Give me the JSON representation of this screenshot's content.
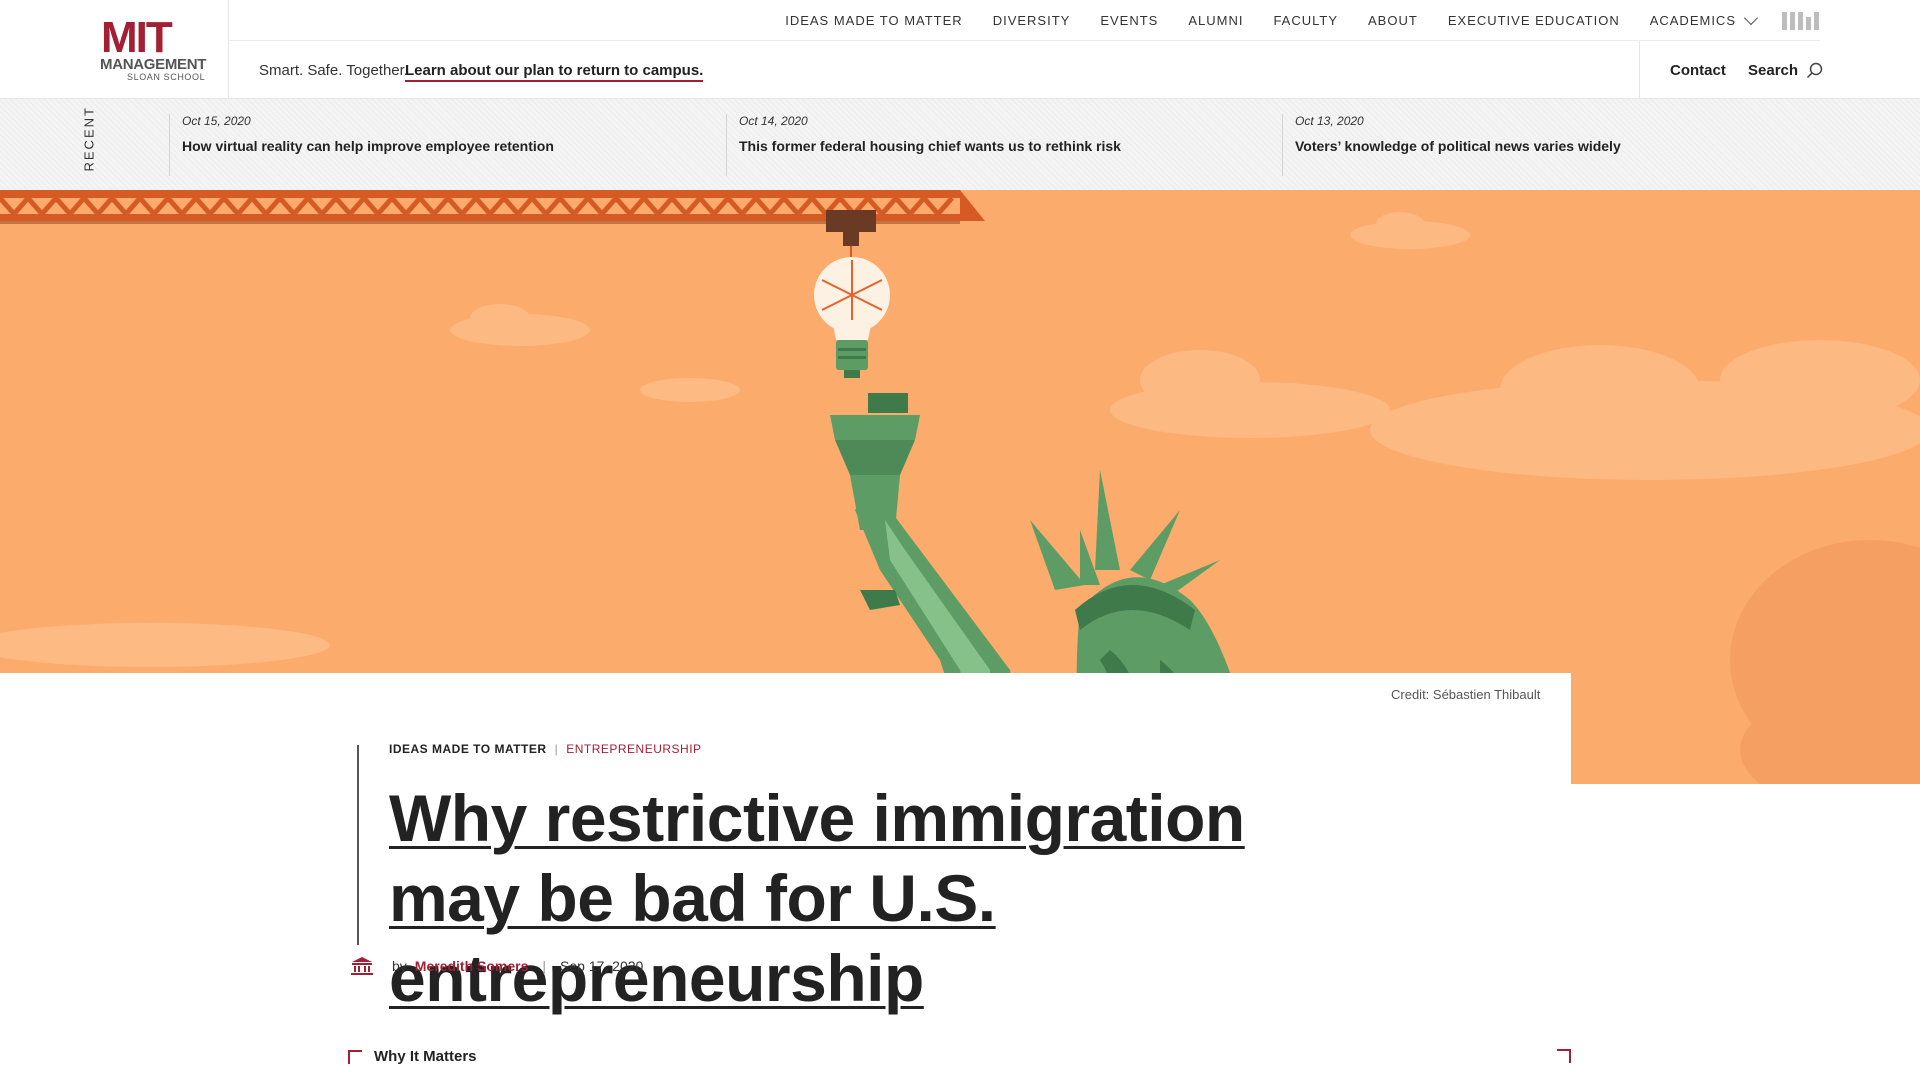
{
  "logo": {
    "mit": "MIT",
    "management": "MANAGEMENT",
    "sloan": "SLOAN SCHOOL"
  },
  "topnav": {
    "items": [
      "IDEAS MADE TO MATTER",
      "DIVERSITY",
      "EVENTS",
      "ALUMNI",
      "FACULTY",
      "ABOUT",
      "EXECUTIVE EDUCATION",
      "ACADEMICS"
    ],
    "mit_mark_icon": "mit-logo-icon"
  },
  "subnav": {
    "tagline": "Smart. Safe. Together.",
    "link": "Learn about our plan to return to campus.",
    "contact": "Contact",
    "search": "Search"
  },
  "recent": {
    "label": "RECENT",
    "items": [
      {
        "date": "Oct 15, 2020",
        "title": "How virtual reality can help improve employee retention"
      },
      {
        "date": "Oct 14, 2020",
        "title": "This former federal housing chief wants us to rethink risk"
      },
      {
        "date": "Oct 13, 2020",
        "title": "Voters’ knowledge of political news varies widely"
      }
    ]
  },
  "hero": {
    "credit": "Credit: Sébastien Thibault",
    "background": "#fbab6c",
    "accent": "#5e9c66"
  },
  "article": {
    "crumb_section": "IDEAS MADE TO MATTER",
    "crumb_topic": "ENTREPRENEURSHIP",
    "title": "Why restrictive immigration may be bad for U.S. entrepreneurship",
    "by": "by",
    "author": "Meredith Somers",
    "date": "Sep 17, 2020",
    "why_label": "Why It Matters"
  },
  "colors": {
    "brand": "#a31f34"
  }
}
